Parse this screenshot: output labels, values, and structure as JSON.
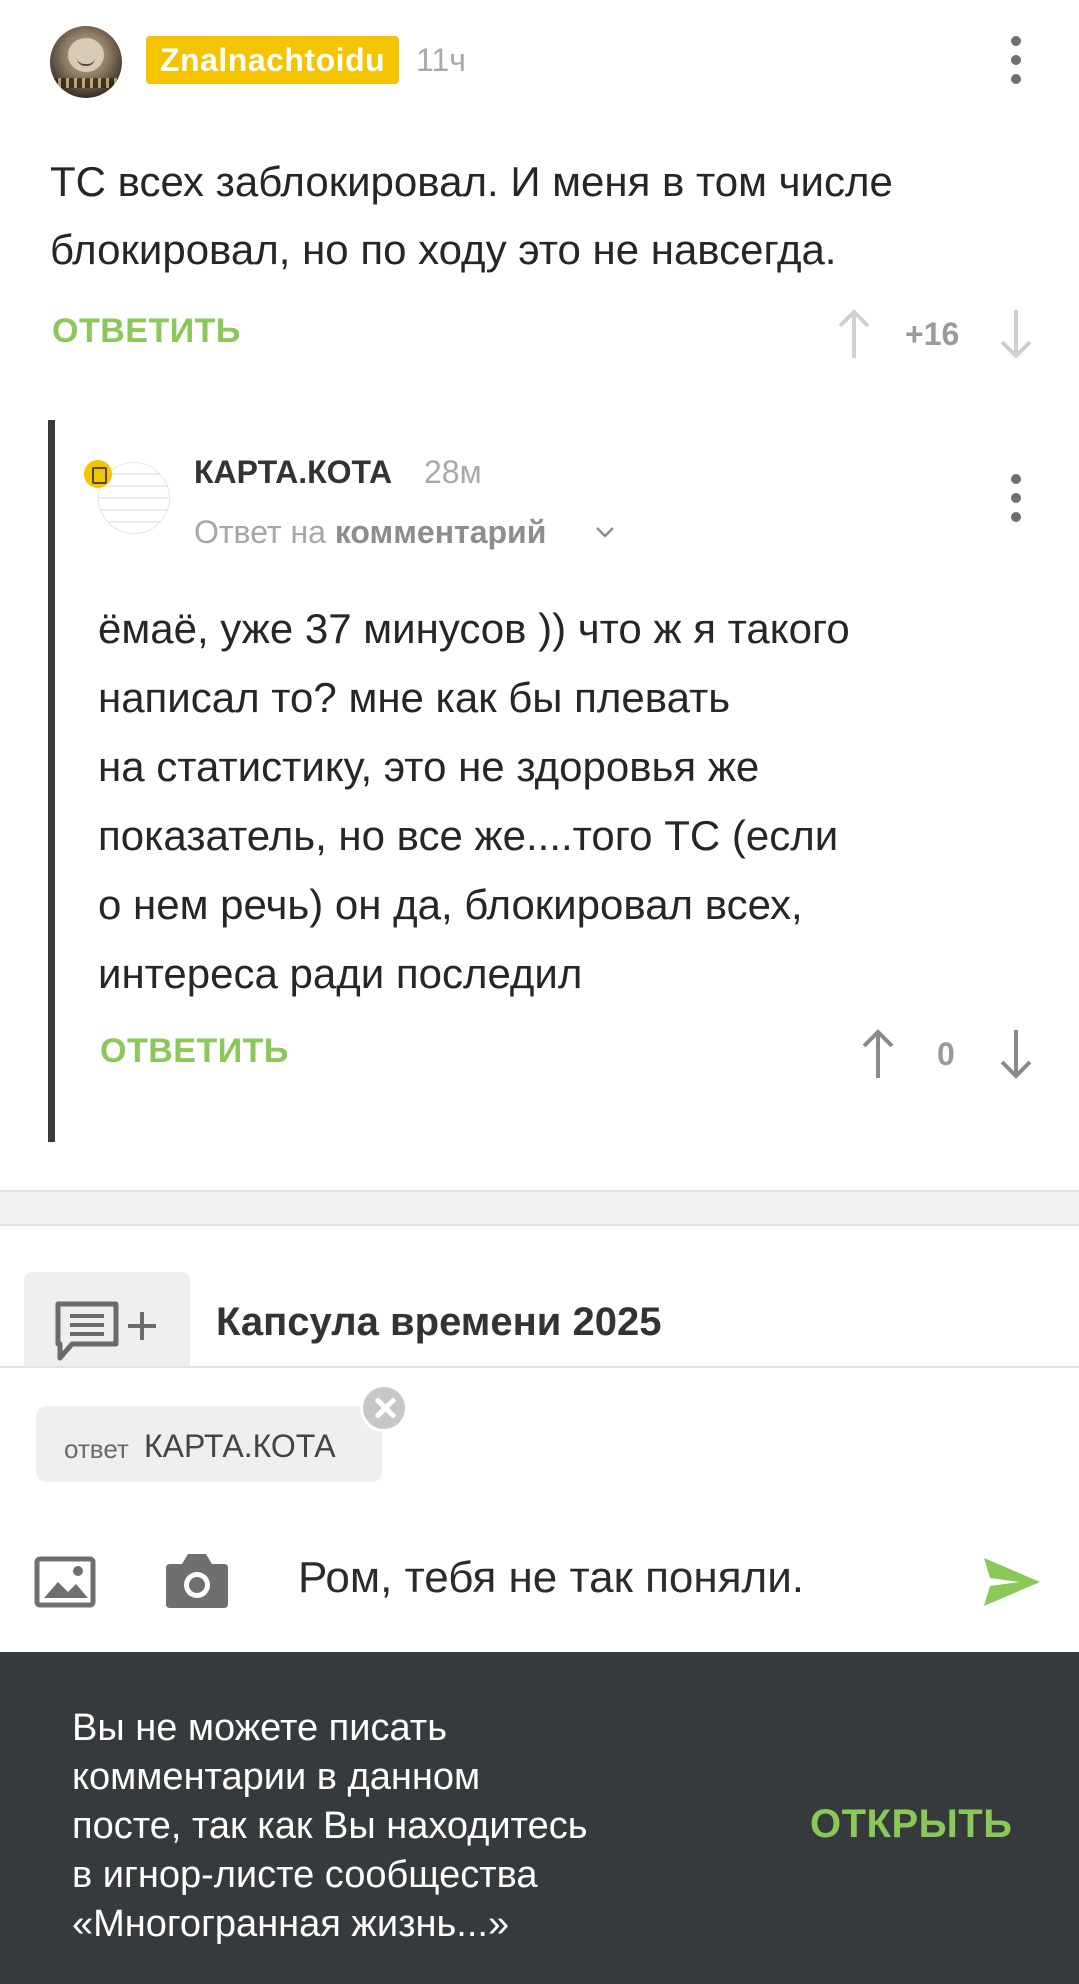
{
  "comments": [
    {
      "author": "Znalnachtoidu",
      "time": "11ч",
      "text_lines": [
        "ТС всех заблокировал. И меня в том числе",
        "блокировал, но по ходу это не навсегда."
      ],
      "reply_label": "ОТВЕТИТЬ",
      "score": "+16"
    },
    {
      "author": "КАРТА.КОТА",
      "time": "28м",
      "reply_to_prefix": "Ответ на",
      "reply_to_target": "комментарий",
      "text_lines": [
        "ёмаё, уже 37 минусов )) что ж я такого",
        "написал то? мне как бы плевать",
        "на статистику, это не здоровья же",
        "показатель, но все же....того ТС (если",
        "о нем речь) он да, блокировал всех,",
        "интереса ради последил"
      ],
      "reply_label": "ОТВЕТИТЬ",
      "score": "0"
    }
  ],
  "compose": {
    "post_title": "Капсула времени 2025",
    "reply_chip_prefix": "ответ",
    "reply_chip_name": "КАРТА.КОТА",
    "input_value": "Ром, тебя не так поняли."
  },
  "banner": {
    "lines": [
      "Вы не можете писать",
      "комментарии в данном",
      "посте, так как Вы находитесь",
      "в игнор-листе сообщества",
      "«Многогранная жизнь...»"
    ],
    "action_label": "ОТКРЫТЬ"
  },
  "colors": {
    "accent_green": "#8ac858",
    "badge_yellow": "#f5c400",
    "banner_bg": "#373a3c"
  }
}
